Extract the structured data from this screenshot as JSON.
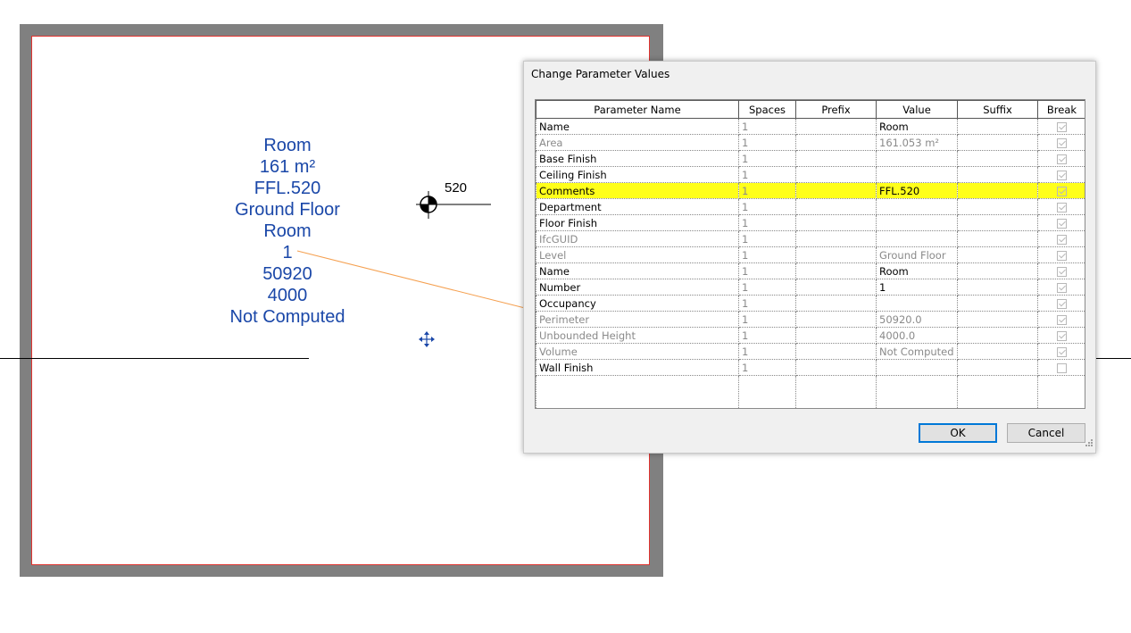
{
  "room_tag": {
    "lines": [
      "Room",
      "161 m²",
      "FFL.520",
      "Ground Floor",
      "Room",
      "1",
      "50920",
      "4000",
      "Not Computed"
    ]
  },
  "level_marker": {
    "value": "520"
  },
  "icons": {
    "level": "level-target-icon",
    "move": "move-arrows-icon",
    "resize": "resize-grip-icon"
  },
  "colors": {
    "highlight": "#ffff1a",
    "tag_text": "#1a47a8",
    "boundary": "#e0332f",
    "leader": "#f5a050"
  },
  "dialog": {
    "title": "Change Parameter Values",
    "columns": [
      "Parameter Name",
      "Spaces",
      "Prefix",
      "Value",
      "Suffix",
      "Break"
    ],
    "rows": [
      {
        "name": "Name",
        "spaces": "1",
        "prefix": "",
        "value": "Room",
        "suffix": "",
        "break": true,
        "readonly": false,
        "highlight": false
      },
      {
        "name": "Area",
        "spaces": "1",
        "prefix": "",
        "value": "161.053 m²",
        "suffix": "",
        "break": true,
        "readonly": true,
        "highlight": false
      },
      {
        "name": "Base Finish",
        "spaces": "1",
        "prefix": "",
        "value": "",
        "suffix": "",
        "break": true,
        "readonly": false,
        "highlight": false
      },
      {
        "name": "Ceiling Finish",
        "spaces": "1",
        "prefix": "",
        "value": "",
        "suffix": "",
        "break": true,
        "readonly": false,
        "highlight": false
      },
      {
        "name": "Comments",
        "spaces": "1",
        "prefix": "",
        "value": "FFL.520",
        "suffix": "",
        "break": true,
        "readonly": false,
        "highlight": true
      },
      {
        "name": "Department",
        "spaces": "1",
        "prefix": "",
        "value": "",
        "suffix": "",
        "break": true,
        "readonly": false,
        "highlight": false
      },
      {
        "name": "Floor Finish",
        "spaces": "1",
        "prefix": "",
        "value": "",
        "suffix": "",
        "break": true,
        "readonly": false,
        "highlight": false
      },
      {
        "name": "IfcGUID",
        "spaces": "1",
        "prefix": "",
        "value": "",
        "suffix": "",
        "break": true,
        "readonly": true,
        "highlight": false
      },
      {
        "name": "Level",
        "spaces": "1",
        "prefix": "",
        "value": "Ground Floor",
        "suffix": "",
        "break": true,
        "readonly": true,
        "highlight": false
      },
      {
        "name": "Name",
        "spaces": "1",
        "prefix": "",
        "value": "Room",
        "suffix": "",
        "break": true,
        "readonly": false,
        "highlight": false
      },
      {
        "name": "Number",
        "spaces": "1",
        "prefix": "",
        "value": "1",
        "suffix": "",
        "break": true,
        "readonly": false,
        "highlight": false
      },
      {
        "name": "Occupancy",
        "spaces": "1",
        "prefix": "",
        "value": "",
        "suffix": "",
        "break": true,
        "readonly": false,
        "highlight": false
      },
      {
        "name": "Perimeter",
        "spaces": "1",
        "prefix": "",
        "value": "50920.0",
        "suffix": "",
        "break": true,
        "readonly": true,
        "highlight": false
      },
      {
        "name": "Unbounded Height",
        "spaces": "1",
        "prefix": "",
        "value": "4000.0",
        "suffix": "",
        "break": true,
        "readonly": true,
        "highlight": false
      },
      {
        "name": "Volume",
        "spaces": "1",
        "prefix": "",
        "value": "Not Computed",
        "suffix": "",
        "break": true,
        "readonly": true,
        "highlight": false
      },
      {
        "name": "Wall Finish",
        "spaces": "1",
        "prefix": "",
        "value": "",
        "suffix": "",
        "break": false,
        "readonly": false,
        "highlight": false
      }
    ],
    "ok_label": "OK",
    "cancel_label": "Cancel"
  }
}
